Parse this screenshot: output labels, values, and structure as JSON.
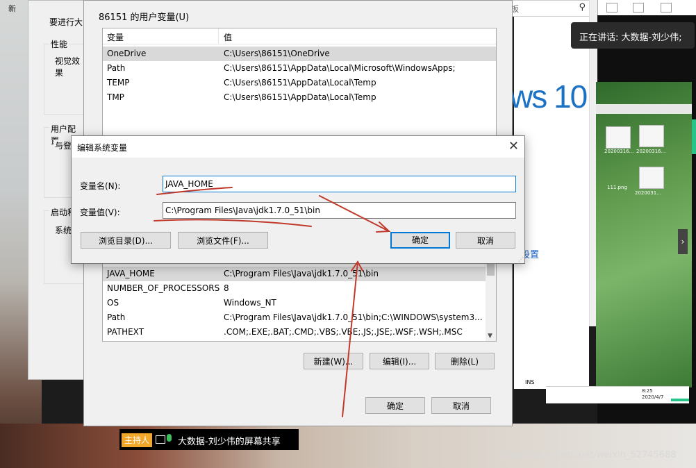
{
  "background": {
    "search_hint": "板",
    "win10_text": "ws 10",
    "settings_link": "设置",
    "ins_label": "INS",
    "sysprop": {
      "intro": "要进行大",
      "perf_label": "性能",
      "perf_text": "视觉效果",
      "profile_label": "用户配置",
      "profile_text": "与登",
      "startup_label": "启动和",
      "startup_text": "系统"
    },
    "desktop_icon_label": "新"
  },
  "user_vars": {
    "group_label": "86151 的用户变量(U)",
    "col_var": "变量",
    "col_val": "值",
    "rows": [
      {
        "name": "OneDrive",
        "value": "C:\\Users\\86151\\OneDrive",
        "selected": true
      },
      {
        "name": "Path",
        "value": "C:\\Users\\86151\\AppData\\Local\\Microsoft\\WindowsApps;"
      },
      {
        "name": "TEMP",
        "value": "C:\\Users\\86151\\AppData\\Local\\Temp"
      },
      {
        "name": "TMP",
        "value": "C:\\Users\\86151\\AppData\\Local\\Temp"
      }
    ]
  },
  "sys_vars": {
    "rows": [
      {
        "name": "JAVA_HOME",
        "value": "C:\\Program Files\\Java\\jdk1.7.0_51\\bin",
        "selected": true
      },
      {
        "name": "NUMBER_OF_PROCESSORS",
        "value": "8"
      },
      {
        "name": "OS",
        "value": "Windows_NT"
      },
      {
        "name": "Path",
        "value": "C:\\Program Files\\Java\\jdk1.7.0_51\\bin;C:\\WINDOWS\\system3..."
      },
      {
        "name": "PATHEXT",
        "value": ".COM;.EXE;.BAT;.CMD;.VBS;.VBE;.JS;.JSE;.WSF;.WSH;.MSC"
      }
    ],
    "new_btn": "新建(W)...",
    "edit_btn": "编辑(I)...",
    "delete_btn": "删除(L)"
  },
  "env_footer": {
    "ok": "确定",
    "cancel": "取消"
  },
  "edit_dialog": {
    "title": "编辑系统变量",
    "close": "✕",
    "name_label": "变量名(N):",
    "name_value": "JAVA_HOME",
    "value_label": "变量值(V):",
    "value_value": "C:\\Program Files\\Java\\jdk1.7.0_51\\bin",
    "browse_dir": "浏览目录(D)...",
    "browse_file": "浏览文件(F)...",
    "ok": "确定",
    "cancel": "取消"
  },
  "meeting": {
    "speaking": "正在讲话: 大数据-刘少伟;",
    "host_badge": "主持人",
    "share_text": "大数据-刘少伟的屏幕共享"
  },
  "remote_screen": {
    "files": [
      {
        "caption": "20200316..."
      },
      {
        "caption": "20200316..."
      },
      {
        "caption": "111.png"
      },
      {
        "caption": "2020031..."
      }
    ],
    "time": "8:25",
    "date": "2020/4/7"
  },
  "watermark": "https://blog.csdn.net/weixin_52745688",
  "colors": {
    "accent": "#0078d7",
    "annotation": "#c0392b",
    "host_badge": "#f0a72a"
  }
}
